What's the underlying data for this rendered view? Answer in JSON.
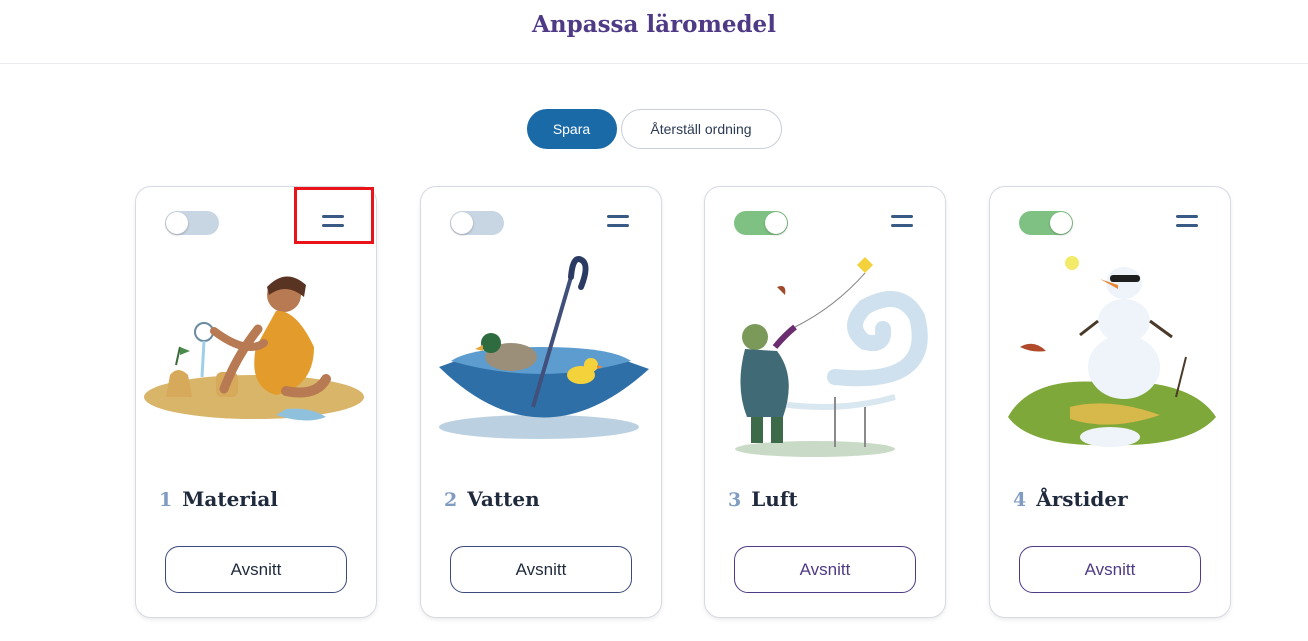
{
  "header": {
    "title": "Anpassa läromedel"
  },
  "actions": {
    "save_label": "Spara",
    "reset_label": "Återställ ordning"
  },
  "cards": [
    {
      "number": "1",
      "title": "Material",
      "button_label": "Avsnitt",
      "enabled": false
    },
    {
      "number": "2",
      "title": "Vatten",
      "button_label": "Avsnitt",
      "enabled": false
    },
    {
      "number": "3",
      "title": "Luft",
      "button_label": "Avsnitt",
      "enabled": true
    },
    {
      "number": "4",
      "title": "Årstider",
      "button_label": "Avsnitt",
      "enabled": true
    }
  ],
  "icons": {
    "drag": "drag-handle-icon"
  },
  "colors": {
    "brand_purple": "#4f3a86",
    "primary_blue": "#1a6aa8",
    "toggle_on": "#7fc183",
    "toggle_off": "#c8d5e2",
    "highlight_red": "#e8141a"
  }
}
